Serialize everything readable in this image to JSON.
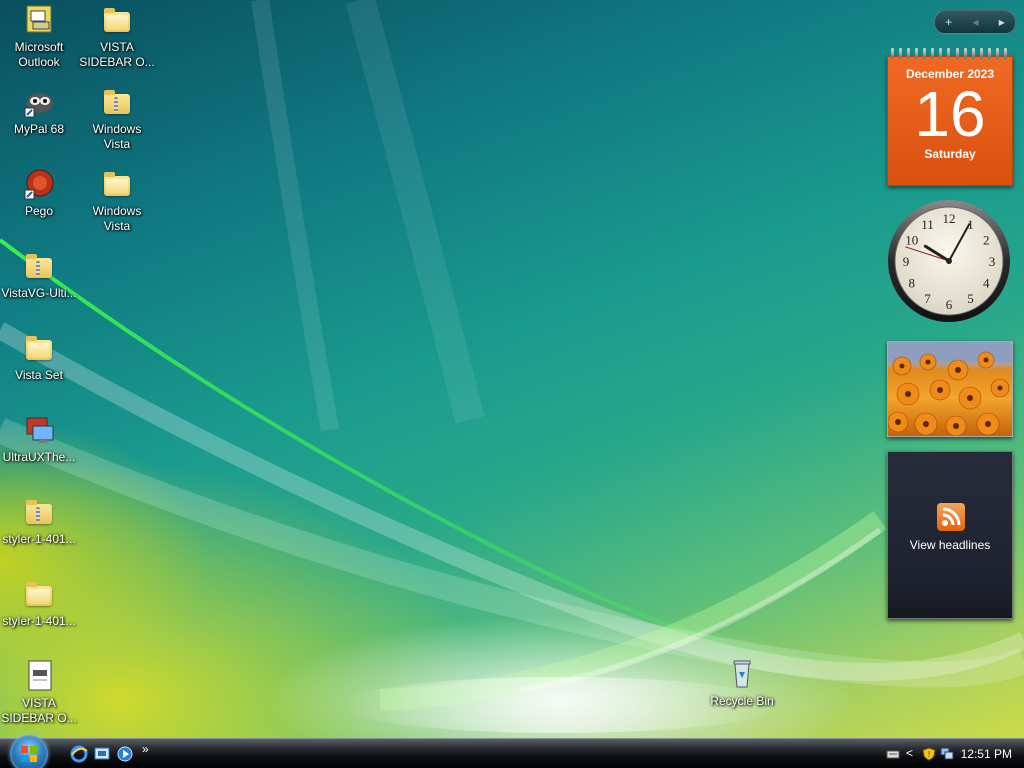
{
  "desktop": {
    "icons": [
      {
        "label": "Microsoft Outlook",
        "icon": "outlook-icon"
      },
      {
        "label": "VISTA SIDEBAR O...",
        "icon": "folder-icon"
      },
      {
        "label": "MyPal 68",
        "icon": "browser-icon"
      },
      {
        "label": "Windows Vista",
        "icon": "zip-folder-icon"
      },
      {
        "label": "Pego",
        "icon": "app-icon"
      },
      {
        "label": "Windows Vista",
        "icon": "folder-icon"
      },
      {
        "label": "VistaVG-Ulti...",
        "icon": "zip-folder-icon"
      },
      {
        "label": "Vista Set",
        "icon": "folder-icon"
      },
      {
        "label": "UltraUXThe...",
        "icon": "monitor-icon"
      },
      {
        "label": "styler-1-401...",
        "icon": "zip-folder-icon"
      },
      {
        "label": "styler-1-401...",
        "icon": "folder-icon"
      },
      {
        "label": "VISTA SIDEBAR O...",
        "icon": "document-icon"
      }
    ],
    "recycle_bin": {
      "label": "Recycle Bin",
      "icon": "recycle-bin-icon"
    }
  },
  "sidebar": {
    "controls": {
      "add": "+",
      "prev": "◂",
      "next": "▸"
    },
    "calendar": {
      "month_year": "December 2023",
      "day": "16",
      "weekday": "Saturday"
    },
    "clock": {
      "hour": 10,
      "minute": 4,
      "second": 48
    },
    "slideshow": {
      "icon": "flowers-photo"
    },
    "feed": {
      "label": "View headlines",
      "icon": "rss-icon"
    }
  },
  "taskbar": {
    "quicklaunch": [
      "internet-explorer-icon",
      "show-desktop-icon",
      "switch-windows-icon"
    ],
    "more": "»",
    "tray": {
      "time": "12:51 PM",
      "chevron": "<"
    }
  }
}
